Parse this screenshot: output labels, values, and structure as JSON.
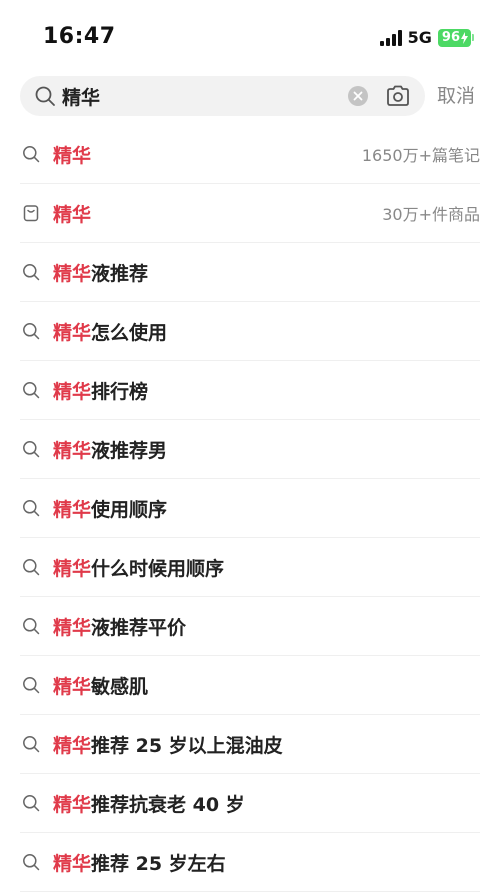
{
  "status_bar": {
    "time": "16:47",
    "network": "5G",
    "battery": "96"
  },
  "search": {
    "query": "精华",
    "cancel_label": "取消"
  },
  "suggestions": [
    {
      "highlight": "精华",
      "rest": "",
      "meta": "1650万+篇笔记",
      "icon": "search-icon"
    },
    {
      "highlight": "精华",
      "rest": "",
      "meta": "30万+件商品",
      "icon": "shopping-bag-icon"
    },
    {
      "highlight": "精华",
      "rest": "液推荐",
      "meta": "",
      "icon": "search-icon"
    },
    {
      "highlight": "精华",
      "rest": "怎么使用",
      "meta": "",
      "icon": "search-icon"
    },
    {
      "highlight": "精华",
      "rest": "排行榜",
      "meta": "",
      "icon": "search-icon"
    },
    {
      "highlight": "精华",
      "rest": "液推荐男",
      "meta": "",
      "icon": "search-icon"
    },
    {
      "highlight": "精华",
      "rest": "使用顺序",
      "meta": "",
      "icon": "search-icon"
    },
    {
      "highlight": "精华",
      "rest": "什么时候用顺序",
      "meta": "",
      "icon": "search-icon"
    },
    {
      "highlight": "精华",
      "rest": "液推荐平价",
      "meta": "",
      "icon": "search-icon"
    },
    {
      "highlight": "精华",
      "rest": "敏感肌",
      "meta": "",
      "icon": "search-icon"
    },
    {
      "highlight": "精华",
      "rest": "推荐 25 岁以上混油皮",
      "meta": "",
      "icon": "search-icon"
    },
    {
      "highlight": "精华",
      "rest": "推荐抗衰老 40 岁",
      "meta": "",
      "icon": "search-icon"
    },
    {
      "highlight": "精华",
      "rest": "推荐 25 岁左右",
      "meta": "",
      "icon": "search-icon"
    }
  ],
  "colors": {
    "highlight": "#e03a4a",
    "battery": "#4cd964"
  }
}
